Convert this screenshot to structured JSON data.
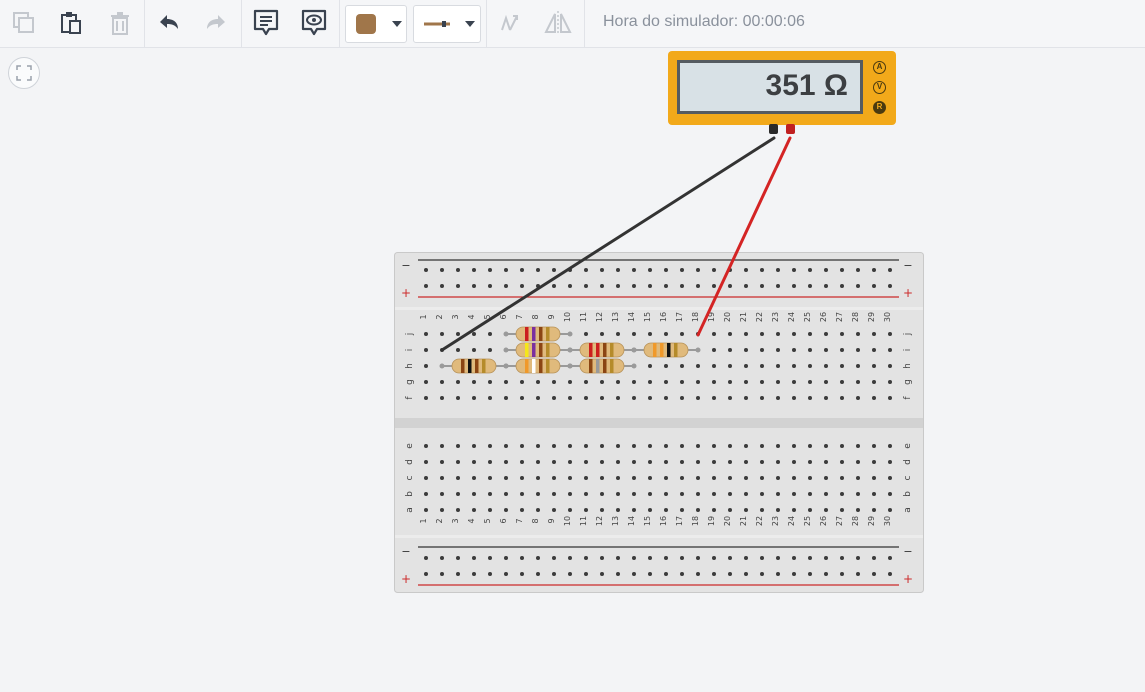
{
  "toolbar": {
    "buttons": [
      {
        "name": "copy-button",
        "icon": "copy-icon",
        "enabled": false
      },
      {
        "name": "paste-button",
        "icon": "clipboard-icon",
        "enabled": true
      },
      {
        "name": "delete-button",
        "icon": "trash-icon",
        "enabled": false
      },
      {
        "name": "undo-button",
        "icon": "undo-icon",
        "enabled": true
      },
      {
        "name": "redo-button",
        "icon": "redo-icon",
        "enabled": false
      },
      {
        "name": "notes-button",
        "icon": "note-icon",
        "enabled": true
      },
      {
        "name": "view-button",
        "icon": "eye-icon",
        "enabled": true
      },
      {
        "name": "rotate-button",
        "icon": "rotate-icon",
        "enabled": false
      },
      {
        "name": "mirror-button",
        "icon": "mirror-icon",
        "enabled": false
      }
    ],
    "color_dropdown": {
      "selected_color": "#a0764a"
    },
    "wire_dropdown": {
      "selected_style": "wire-straight"
    },
    "simulator_time": "Hora do simulador: 00:00:06"
  },
  "canvas": {
    "fit_button_icon": "fit-to-screen-icon"
  },
  "multimeter": {
    "reading": "351 Ω",
    "modes": [
      "A",
      "V",
      "R"
    ],
    "active_mode": "R",
    "probe_colors": {
      "negative": "#333333",
      "positive": "#cc2222"
    }
  },
  "breadboard": {
    "columns": 30,
    "top_row_labels": [
      "j",
      "i",
      "h",
      "g",
      "f"
    ],
    "bottom_row_labels": [
      "e",
      "d",
      "c",
      "b",
      "a"
    ],
    "rail_minus_label": "−",
    "rail_plus_label": "+"
  },
  "colors": {
    "accent": "#f2a91a",
    "rail_red": "#cc2a2a",
    "rail_dark": "#333333"
  }
}
